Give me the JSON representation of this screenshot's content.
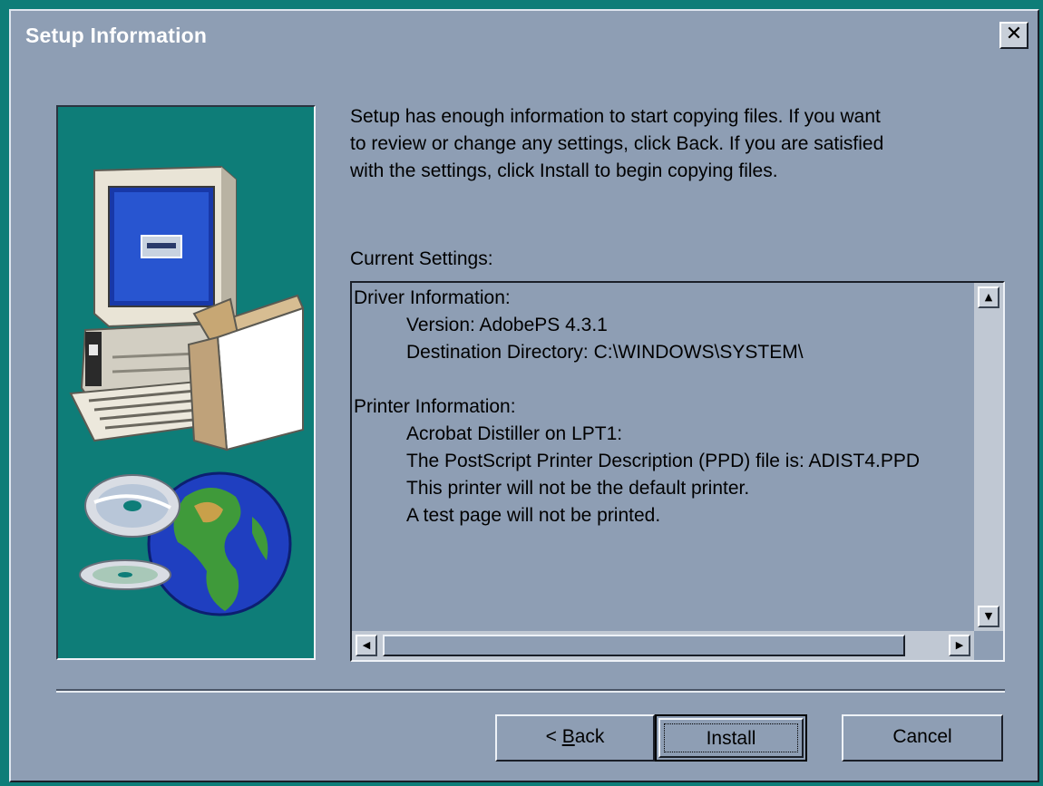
{
  "window": {
    "title": "Setup Information",
    "close_label": "✕"
  },
  "intro": {
    "lines": [
      "Setup has enough information to start copying files.  If you want",
      "to review or change any settings, click Back.  If you are satisfied",
      "with the settings, click Install to begin copying files."
    ]
  },
  "settings": {
    "label": "Current Settings:",
    "lines": [
      {
        "text": "Driver Information:",
        "indent": false
      },
      {
        "text": "Version: AdobePS 4.3.1",
        "indent": true
      },
      {
        "text": "Destination Directory: C:\\WINDOWS\\SYSTEM\\",
        "indent": true
      },
      {
        "text": "",
        "indent": false
      },
      {
        "text": "Printer Information:",
        "indent": false
      },
      {
        "text": "Acrobat Distiller on LPT1:",
        "indent": true
      },
      {
        "text": "The PostScript Printer Description (PPD) file is: ADIST4.PPD",
        "indent": true
      },
      {
        "text": "This printer will not be the default printer.",
        "indent": true
      },
      {
        "text": "A test page will not be printed.",
        "indent": true
      }
    ]
  },
  "buttons": {
    "back_prefix": "< ",
    "back_accel": "B",
    "back_rest": "ack",
    "install": "Install",
    "cancel": "Cancel"
  },
  "icons": {
    "scroll_up": "▲",
    "scroll_down": "▼",
    "scroll_left": "◀",
    "scroll_right": "▶"
  },
  "colors": {
    "desktop": "#0e7d78",
    "dialog_face": "#8e9eb4",
    "title_text": "#ffffff"
  }
}
